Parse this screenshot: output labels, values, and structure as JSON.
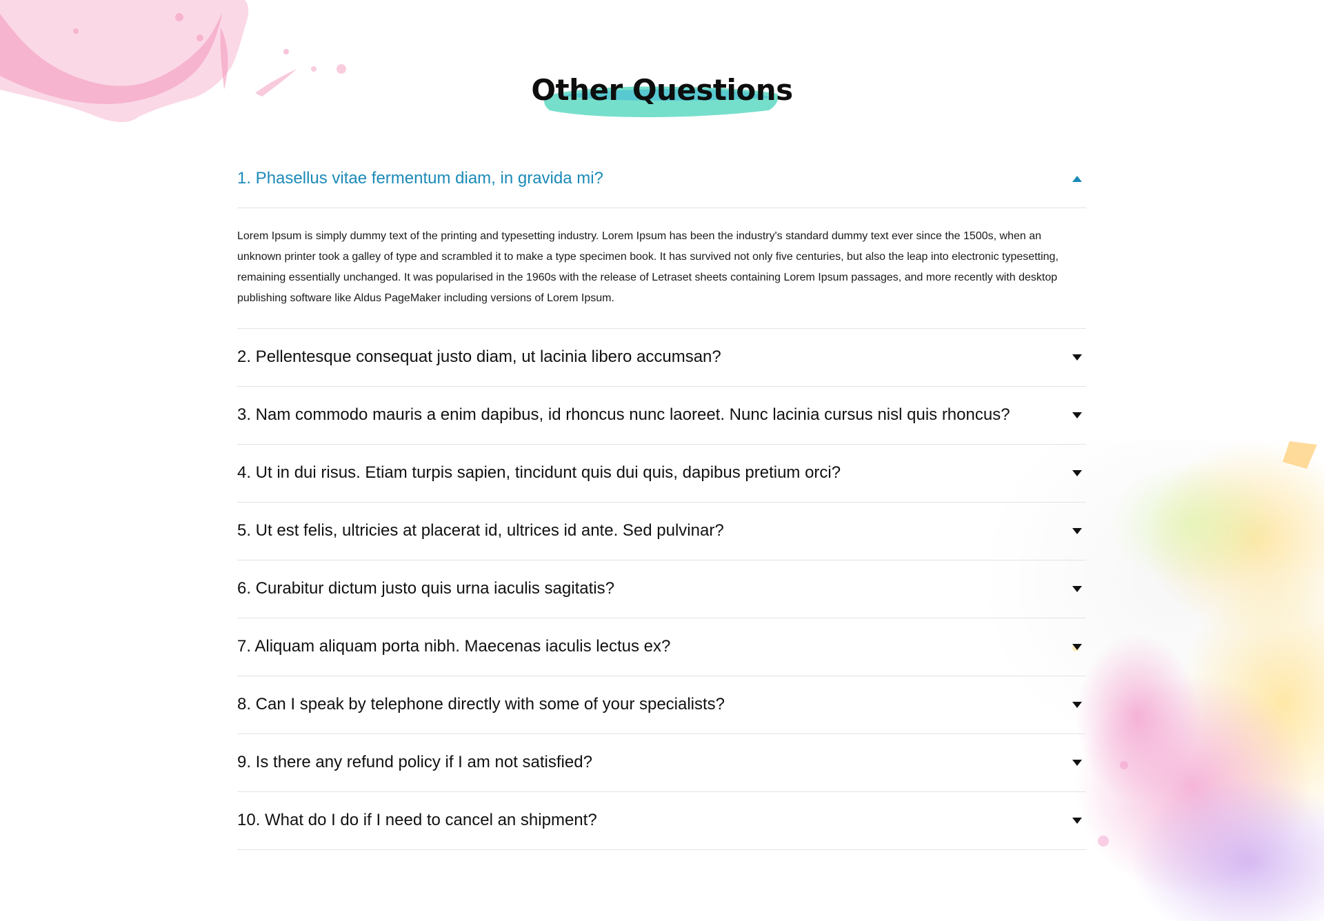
{
  "colors": {
    "accent": "#1b8ab8",
    "text": "#111111",
    "divider": "#e3e3e3",
    "brush": "#5fd6c3"
  },
  "section": {
    "title": "Other Questions"
  },
  "faq": [
    {
      "question": "1. Phasellus vitae fermentum diam, in gravida mi?",
      "answer": "Lorem Ipsum is simply dummy text of the printing and typesetting industry. Lorem Ipsum has been the industry's standard dummy text ever since the 1500s, when an unknown printer took a galley of type and scrambled it to make a type specimen book. It has survived not only five centuries, but also the leap into electronic typesetting, remaining essentially unchanged. It was popularised in the 1960s with the release of Letraset sheets containing Lorem Ipsum passages, and more recently with desktop publishing software like Aldus PageMaker including versions of Lorem Ipsum.",
      "expanded": true,
      "icon": "chevron-up-icon"
    },
    {
      "question": "2. Pellentesque consequat justo diam, ut lacinia libero accumsan?",
      "expanded": false,
      "icon": "chevron-down-icon"
    },
    {
      "question": "3. Nam commodo mauris a enim dapibus, id rhoncus nunc laoreet. Nunc lacinia cursus nisl quis rhoncus?",
      "expanded": false,
      "icon": "chevron-down-icon"
    },
    {
      "question": "4. Ut in dui risus. Etiam turpis sapien, tincidunt quis dui quis, dapibus pretium orci?",
      "expanded": false,
      "icon": "chevron-down-icon"
    },
    {
      "question": "5. Ut est felis, ultricies at placerat id, ultrices id ante. Sed pulvinar?",
      "expanded": false,
      "icon": "chevron-down-icon"
    },
    {
      "question": "6. Curabitur dictum justo quis urna iaculis sagitatis?",
      "expanded": false,
      "icon": "chevron-down-icon"
    },
    {
      "question": "7. Aliquam aliquam porta nibh. Maecenas iaculis lectus ex?",
      "expanded": false,
      "icon": "chevron-down-icon"
    },
    {
      "question": "8. Can I speak by telephone directly with some of your specialists?",
      "expanded": false,
      "icon": "chevron-down-icon"
    },
    {
      "question": "9. Is there any refund policy if I am not satisfied?",
      "expanded": false,
      "icon": "chevron-down-icon"
    },
    {
      "question": "10. What do I do if I need to cancel an shipment?",
      "expanded": false,
      "icon": "chevron-down-icon"
    }
  ]
}
